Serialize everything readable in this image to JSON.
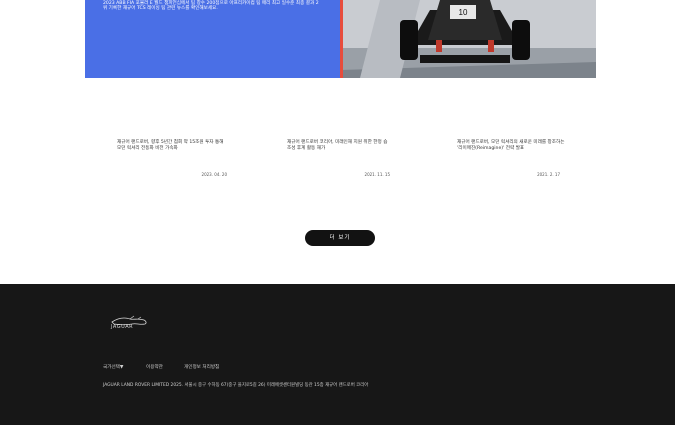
{
  "hero": {
    "description": "2023 ABB FIA 포뮬러 E 월드 챔피언십에서 팀 창수 200점으로 아프리카이컴 팀 매리 최고 일수준 최종 결과 2위 기록한 재규어 TCS 레이싱 팀 관련 뉴스를 확인해보세요.",
    "image_icon": "race-car-photo"
  },
  "news": [
    {
      "title": "재규어 랜드로버, 향후 5년간 첨회 약 15조원 투자 통해 모던 럭셔리 전동화 비전 가속화",
      "date": "2023. 04. 20"
    },
    {
      "title": "재규어 랜드로버 코리아, 미래인재 지원 취한 한정 숍 조성 후계 활동 재가",
      "date": "2021. 11. 15"
    },
    {
      "title": "재규어 랜드로버, 모던 럭셔리의 새로운 미래를 창조하는 '리이매진(Reimagine)' 전략 발표",
      "date": "2021. 2. 17"
    }
  ],
  "more_button": {
    "label": "더 보기"
  },
  "footer": {
    "logo_text": "JAGUAR",
    "links": {
      "country": "국가선택▼",
      "terms": "이용약관",
      "privacy": "개인정보 처리방침"
    },
    "copyright": "JAGUAR LAND ROVER LIMITED 2025. 서울시 중구 수하동 67(중구 을지로5길 26) 미래에셋센터원빌딩 동관 15층 재규어 랜드로버 코리아"
  }
}
